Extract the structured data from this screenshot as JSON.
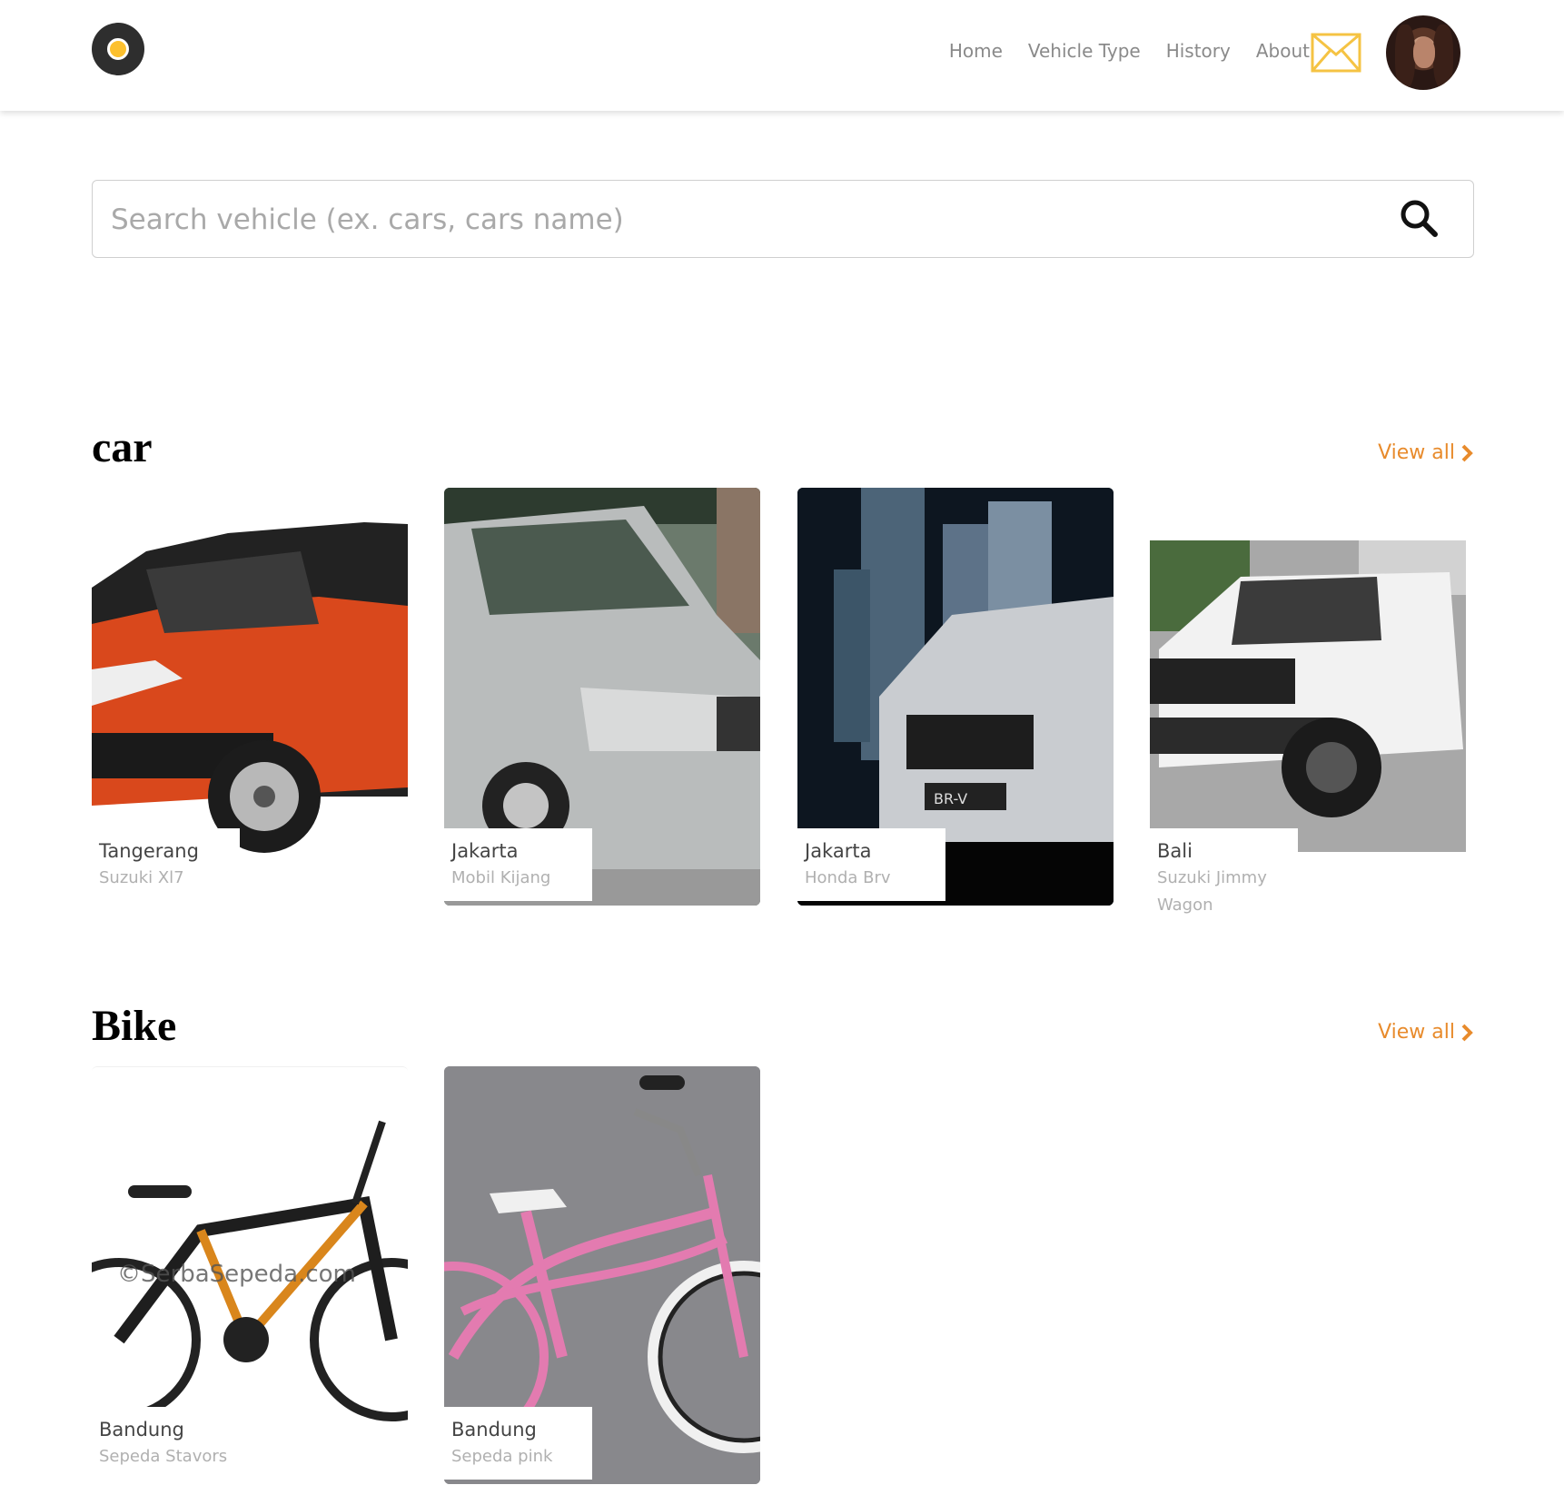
{
  "nav": {
    "links": [
      "Home",
      "Vehicle Type",
      "History",
      "About"
    ]
  },
  "search": {
    "placeholder": "Search vehicle (ex. cars, cars name)"
  },
  "sections": [
    {
      "title": "car",
      "view_all": "View all",
      "items": [
        {
          "city": "Tangerang",
          "name": "Suzuki Xl7"
        },
        {
          "city": "Jakarta",
          "name": "Mobil Kijang"
        },
        {
          "city": "Jakarta",
          "name": "Honda Brv"
        },
        {
          "city": "Bali",
          "name": "Suzuki Jimmy Wagon"
        }
      ]
    },
    {
      "title": "Bike",
      "view_all": "View all",
      "items": [
        {
          "city": "Bandung",
          "name": "Sepeda Stavors"
        },
        {
          "city": "Bandung",
          "name": "Sepeda pink"
        }
      ]
    }
  ],
  "image_text": {
    "watermark": "©SerbaSepeda.com",
    "plate": "BR-V"
  },
  "colors": {
    "accent": "#e88b2c",
    "logo_yellow": "#fcc02e",
    "mail_icon": "#f5c343"
  },
  "icons": [
    "logo",
    "mail-icon",
    "search-icon",
    "chevron-right-icon"
  ]
}
